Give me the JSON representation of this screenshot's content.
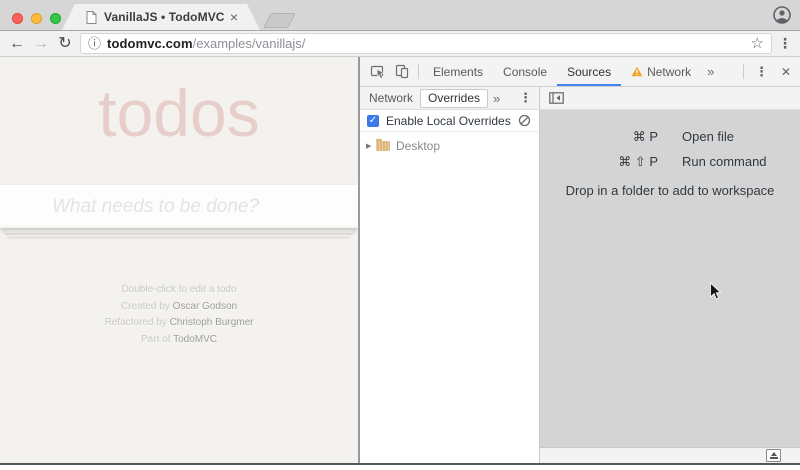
{
  "colors": {
    "accent_blue": "#4285f4",
    "checkbox_blue": "#3b78e8",
    "warning_orange": "#f0a32e",
    "todos_title_pink": "rgba(175,47,47,0.18)",
    "editor_gray": "#d4d4d4",
    "toolbar_gray": "#f3f3f3",
    "traffic_red": "#fc615d",
    "traffic_yellow": "#fdbc40",
    "traffic_green": "#34c749"
  },
  "browser": {
    "tab_title": "VanillaJS • TodoMVC",
    "url_host": "todomvc.com",
    "url_path": "/examples/vanillajs/"
  },
  "icons": {
    "back": "←",
    "forward": "→",
    "reload": "↻",
    "info": "ⓘ",
    "star": "☆",
    "menu": "⋮",
    "tab_close": "×",
    "overflow": "»",
    "dt_menu": "⋮",
    "dt_close": "✕",
    "disclosure": "▶",
    "check": "✓"
  },
  "todo_app": {
    "title": "todos",
    "placeholder": "What needs to be done?",
    "footer": [
      {
        "text": "Double-click to edit a todo",
        "link": ""
      },
      {
        "text": "Created by ",
        "link": "Oscar Godson"
      },
      {
        "text": "Refactored by ",
        "link": "Christoph Burgmer"
      },
      {
        "text": "Part of ",
        "link": "TodoMVC"
      }
    ]
  },
  "devtools": {
    "main_tabs": [
      "Elements",
      "Console",
      "Sources",
      "Network"
    ],
    "selected_main_tab": "Sources",
    "sidebar_tabs": [
      "Network",
      "Overrides"
    ],
    "selected_sidebar_tab": "Overrides",
    "enable_overrides_label": "Enable Local Overrides",
    "enable_overrides_checked": true,
    "tree_folder": "Desktop",
    "shortcuts": [
      {
        "keys": "⌘ P",
        "action": "Open file"
      },
      {
        "keys": "⌘ ⇧ P",
        "action": "Run command"
      }
    ],
    "drop_hint": "Drop in a folder to add to workspace"
  }
}
